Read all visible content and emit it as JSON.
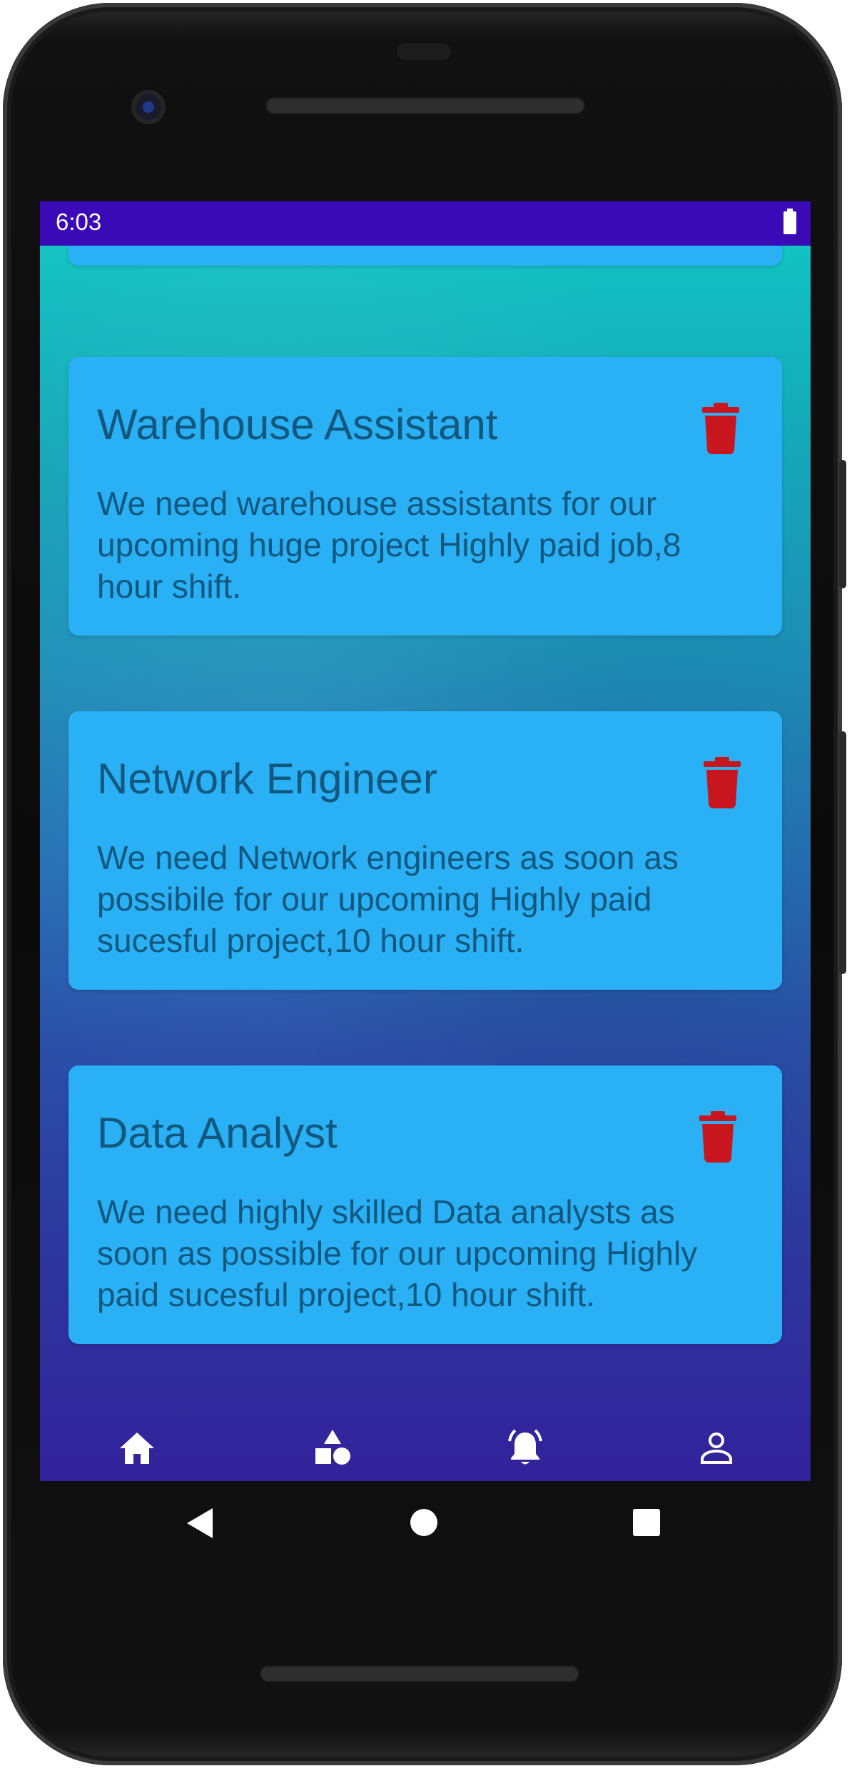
{
  "status_bar": {
    "time": "6:03",
    "battery_icon": "battery-full-icon"
  },
  "cards": [
    {
      "title": "Warehouse Assistant",
      "body": "We need warehouse assistants for our upcoming huge project Highly paid job,8 hour shift.",
      "delete_icon": "trash-icon"
    },
    {
      "title": "Network Engineer",
      "body": "We need Network engineers as soon as possibile for our upcoming Highly paid sucesful project,10 hour shift.",
      "delete_icon": "trash-icon"
    },
    {
      "title": "Data Analyst",
      "body": "We need highly skilled Data analysts as soon as possible for our upcoming Highly paid sucesful project,10 hour shift.",
      "delete_icon": "trash-icon"
    }
  ],
  "bottom_nav": [
    {
      "icon": "home-icon"
    },
    {
      "icon": "shapes-icon"
    },
    {
      "icon": "notification-bell-icon"
    },
    {
      "icon": "person-icon"
    }
  ],
  "system_nav": {
    "back_icon": "back-triangle-icon",
    "home_icon": "home-circle-icon",
    "recents_icon": "recents-square-icon"
  },
  "colors": {
    "status_bar": "#3a0ab6",
    "card": "#29b0f5",
    "card_text": "#12577e",
    "delete": "#c8161e",
    "background_top": "#12c8c4",
    "background_bottom": "#32219b"
  }
}
